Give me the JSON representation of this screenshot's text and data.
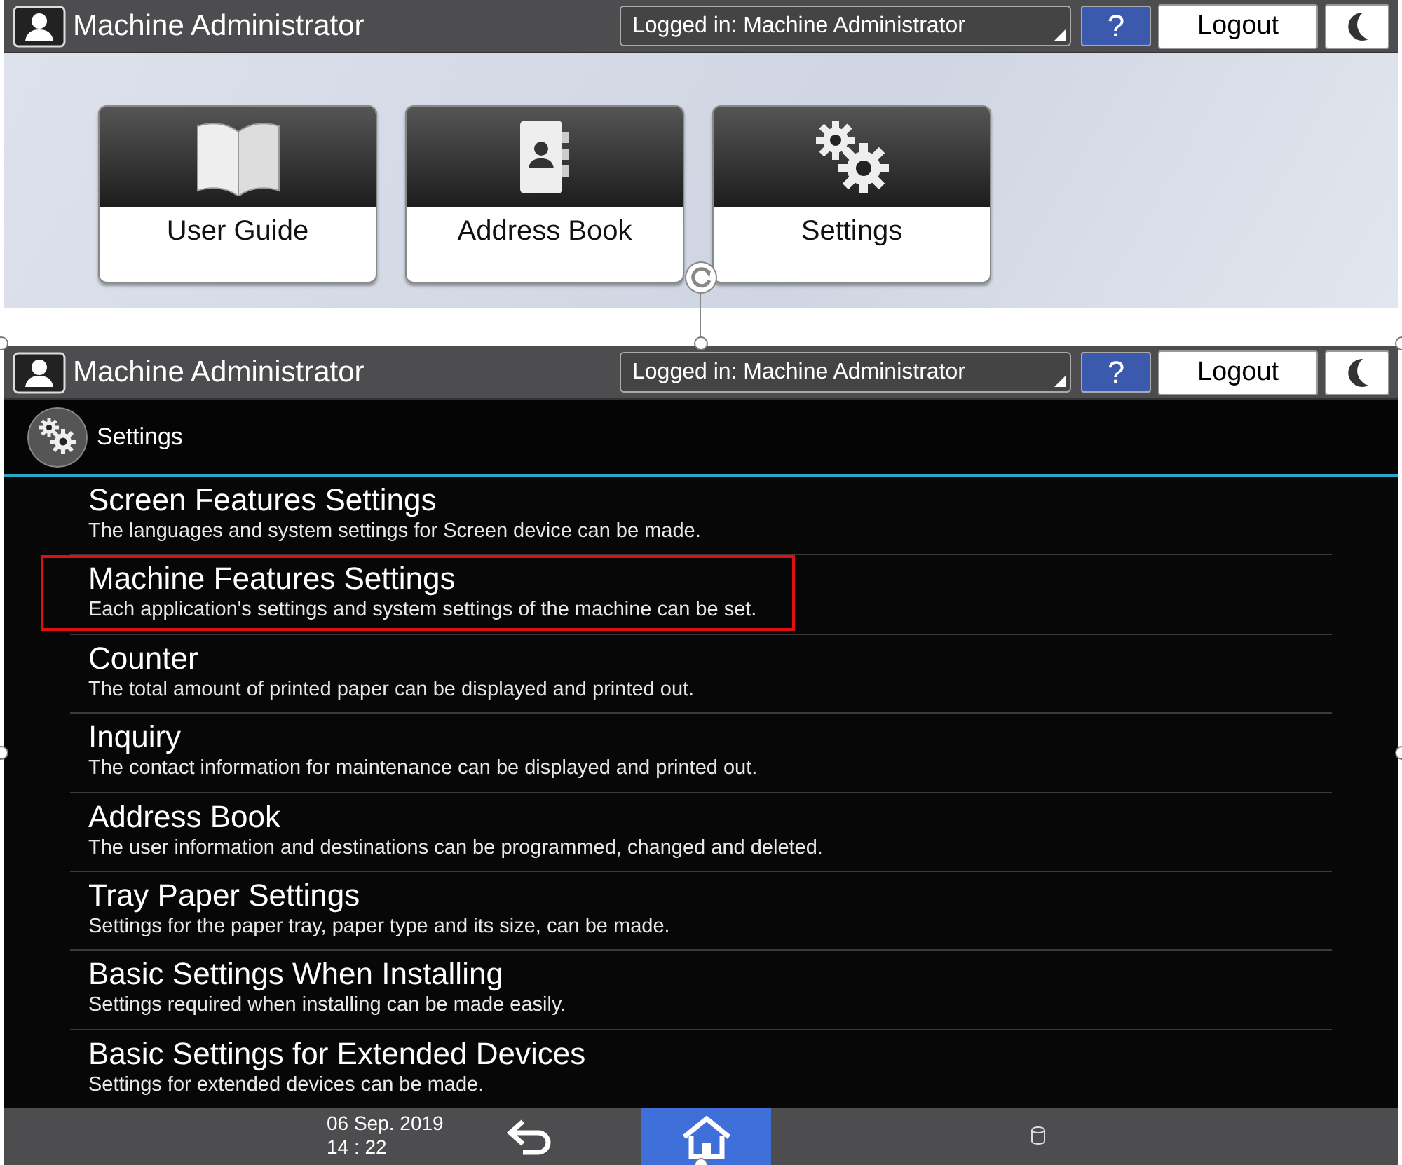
{
  "top_screen": {
    "header": {
      "title": "Machine Administrator",
      "login": "Logged in: Machine Administrator",
      "help": "?",
      "logout": "Logout"
    },
    "apps": [
      {
        "label": "User Guide",
        "kind": "book"
      },
      {
        "label": "Address Book",
        "kind": "contacts"
      },
      {
        "label": "Settings",
        "kind": "gears"
      }
    ]
  },
  "main_screen": {
    "header": {
      "title": "Machine Administrator",
      "login": "Logged in: Machine Administrator",
      "help": "?",
      "logout": "Logout"
    },
    "section": {
      "title": "Settings"
    },
    "items": [
      {
        "title": "Screen Features Settings",
        "description": "The languages and system settings for Screen device can be made.",
        "highlighted": false
      },
      {
        "title": "Machine Features Settings",
        "description": "Each application's settings and system settings of the machine can be set.",
        "highlighted": true
      },
      {
        "title": "Counter",
        "description": "The total amount of printed paper can be displayed and printed out.",
        "highlighted": false
      },
      {
        "title": "Inquiry",
        "description": "The contact information for maintenance can be displayed and printed out.",
        "highlighted": false
      },
      {
        "title": "Address Book",
        "description": "The user information and destinations can be programmed, changed and deleted.",
        "highlighted": false
      },
      {
        "title": "Tray Paper Settings",
        "description": "Settings for the paper tray, paper type and its size, can be made.",
        "highlighted": false
      },
      {
        "title": "Basic Settings When Installing",
        "description": "Settings required when installing can be made easily.",
        "highlighted": false
      },
      {
        "title": "Basic Settings for Extended Devices",
        "description": "Settings for extended devices can be made.",
        "highlighted": false
      }
    ],
    "footer": {
      "date": "06 Sep. 2019",
      "time": "14 : 22"
    }
  }
}
